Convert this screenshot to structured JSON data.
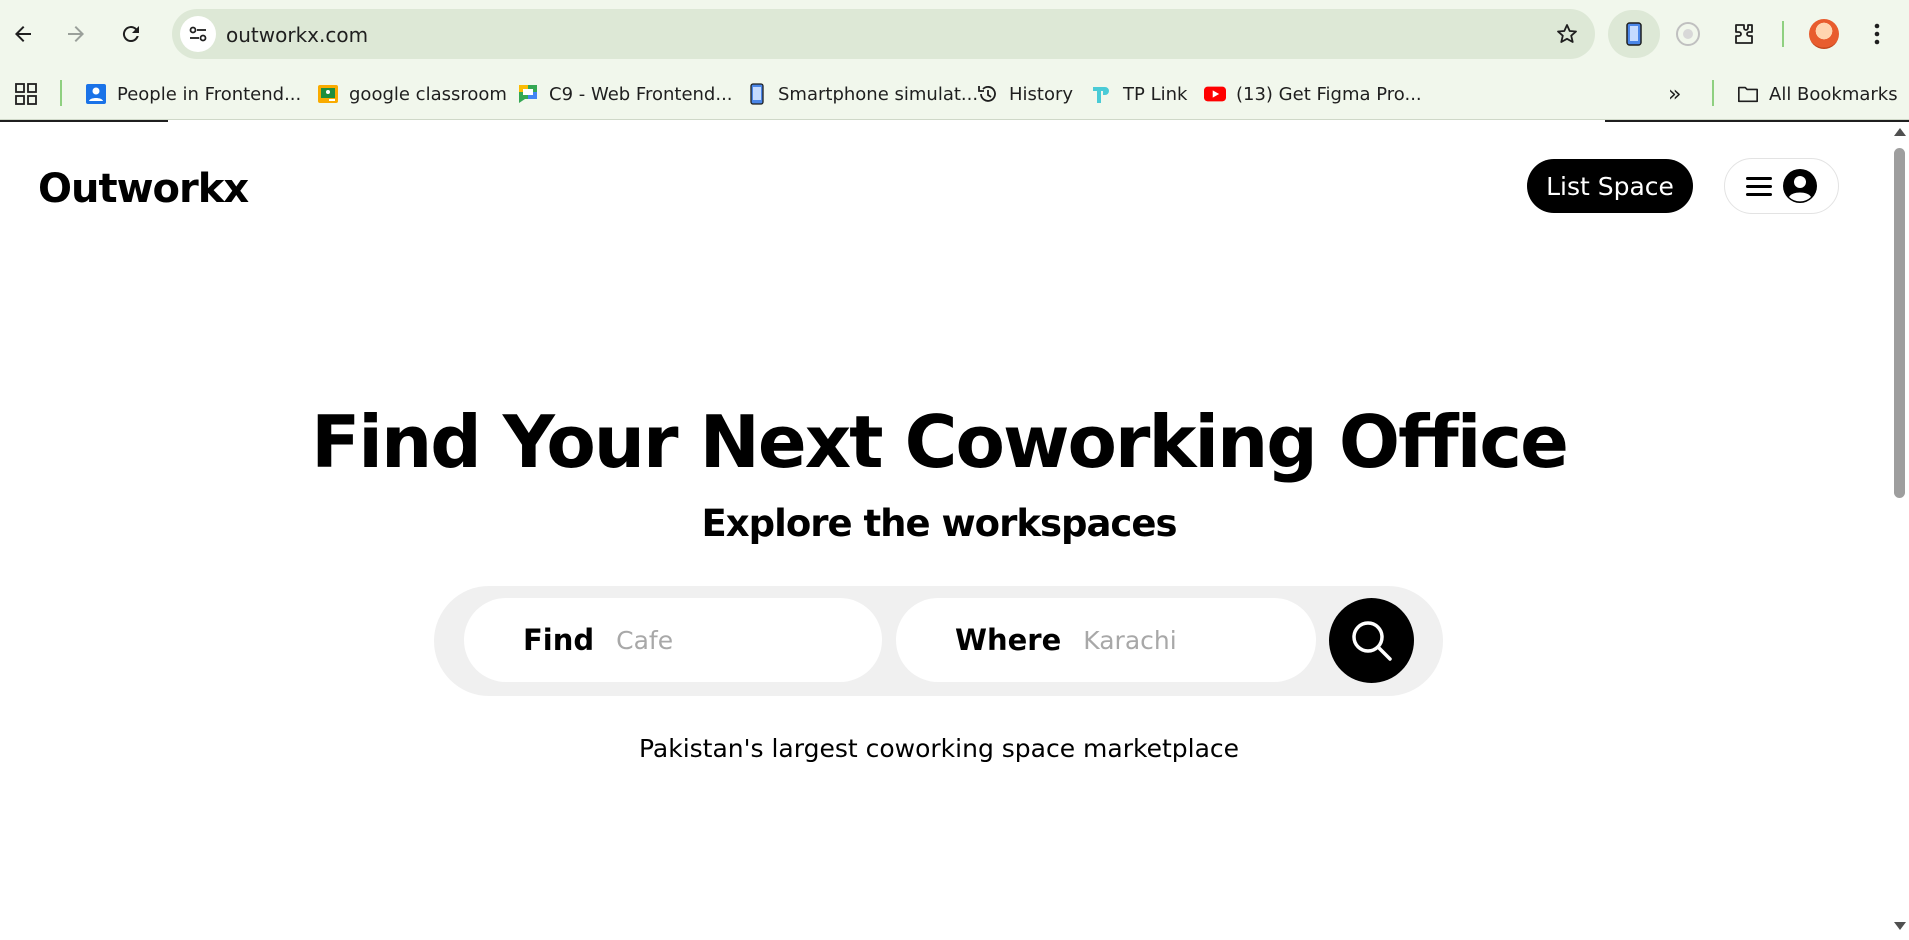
{
  "browser": {
    "url": "outworkx.com",
    "bookmarks": [
      {
        "label": "People in Frontend...",
        "icon": "contacts-icon"
      },
      {
        "label": "google classroom",
        "icon": "classroom-icon"
      },
      {
        "label": "C9 - Web Frontend...",
        "icon": "chat-icon"
      },
      {
        "label": "Smartphone simulat...",
        "icon": "phone-icon"
      },
      {
        "label": "History",
        "icon": "history-icon"
      },
      {
        "label": "TP Link",
        "icon": "tplink-icon"
      },
      {
        "label": "(13) Get Figma Pro...",
        "icon": "youtube-icon"
      }
    ],
    "all_bookmarks_label": "All Bookmarks",
    "accent_color": "#f1f7ec"
  },
  "header": {
    "logo": "Outworkx",
    "list_space_label": "List Space"
  },
  "hero": {
    "title": "Find Your Next Coworking Office",
    "subtitle": "Explore the workspaces"
  },
  "search": {
    "find_label": "Find",
    "find_placeholder": "Cafe",
    "where_label": "Where",
    "where_placeholder": "Karachi"
  },
  "tagline": "Pakistan's largest coworking space marketplace"
}
